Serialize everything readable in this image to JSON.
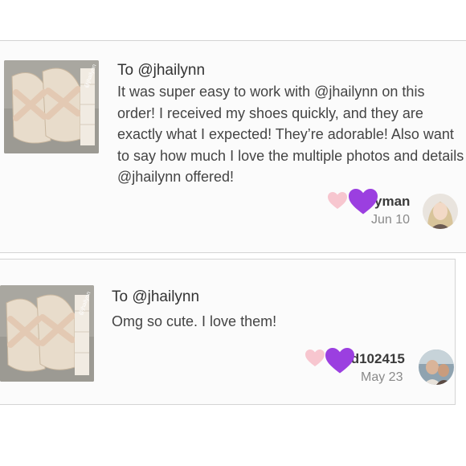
{
  "reviews": [
    {
      "to": "To @jhailynn",
      "body": "It was super easy to work with @jhailynn on this order! I received my shoes quickly, and they are exactly what I expected! They’re adorable! Also want to say how much I love the multiple photos and details @jhailynn offered!",
      "username": "yman",
      "date": "Jun 10",
      "watermark": "@jhailynn"
    },
    {
      "to": "To @jhailynn",
      "body": "Omg so cute. I love them!",
      "username": "id102415",
      "date": "May 23",
      "watermark": "@jhailynn"
    }
  ],
  "colors": {
    "like_heart": "#f7c6cf",
    "purple_heart": "#9b3fe0",
    "date_gray": "#8a8a8a"
  },
  "icons": [
    "like-heart-icon",
    "purple-heart-emoji-icon"
  ]
}
